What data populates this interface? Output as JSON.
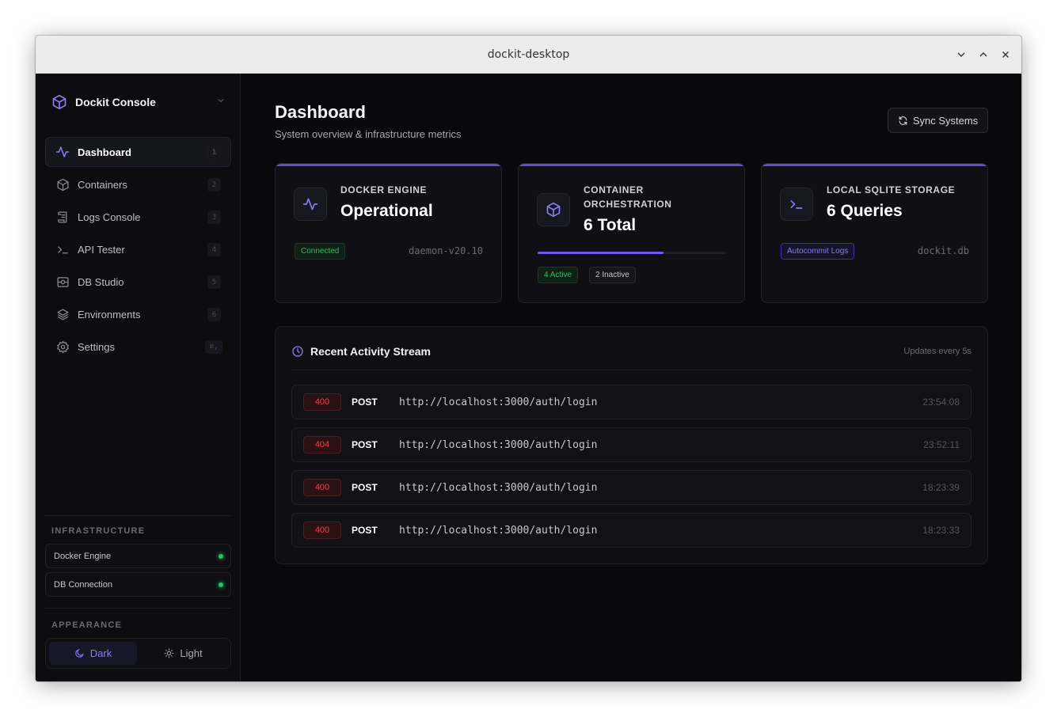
{
  "window": {
    "title": "dockit-desktop"
  },
  "sidebar": {
    "brand": "Dockit Console",
    "items": [
      {
        "label": "Dashboard",
        "key": "1",
        "icon": "activity-icon"
      },
      {
        "label": "Containers",
        "key": "2",
        "icon": "box-icon"
      },
      {
        "label": "Logs Console",
        "key": "3",
        "icon": "scroll-icon"
      },
      {
        "label": "API Tester",
        "key": "4",
        "icon": "terminal-icon"
      },
      {
        "label": "DB Studio",
        "key": "5",
        "icon": "database-icon"
      },
      {
        "label": "Environments",
        "key": "6",
        "icon": "layers-icon"
      },
      {
        "label": "Settings",
        "key": "⌘,",
        "icon": "gear-icon"
      }
    ],
    "infrastructure_label": "INFRASTRUCTURE",
    "infrastructure": [
      {
        "label": "Docker Engine",
        "status": "online"
      },
      {
        "label": "DB Connection",
        "status": "online"
      }
    ],
    "appearance_label": "APPEARANCE",
    "theme": {
      "dark": "Dark",
      "light": "Light",
      "selected": "Dark"
    }
  },
  "main": {
    "title": "Dashboard",
    "subtitle": "System overview & infrastructure metrics",
    "sync_button": "Sync Systems",
    "cards": [
      {
        "label": "DOCKER ENGINE",
        "value": "Operational",
        "badge": "Connected",
        "meta": "daemon-v20.10"
      },
      {
        "label": "CONTAINER ORCHESTRATION",
        "value": "6 Total",
        "progress": 0.667,
        "active": "4 Active",
        "inactive": "2 Inactive"
      },
      {
        "label": "LOCAL SQLITE STORAGE",
        "value": "6 Queries",
        "badge": "Autocommit Logs",
        "meta": "dockit.db"
      }
    ],
    "activity": {
      "title": "Recent Activity Stream",
      "note": "Updates every 5s",
      "rows": [
        {
          "status": "400",
          "method": "POST",
          "url": "http://localhost:3000/auth/login",
          "time": "23:54:08"
        },
        {
          "status": "404",
          "method": "POST",
          "url": "http://localhost:3000/auth/login",
          "time": "23:52:11"
        },
        {
          "status": "400",
          "method": "POST",
          "url": "http://localhost:3000/auth/login",
          "time": "18:23:39"
        },
        {
          "status": "400",
          "method": "POST",
          "url": "http://localhost:3000/auth/login",
          "time": "18:23:33"
        }
      ]
    }
  },
  "colors": {
    "accent": "#8b7cf6",
    "success": "#22c55e",
    "error": "#ef4444"
  }
}
